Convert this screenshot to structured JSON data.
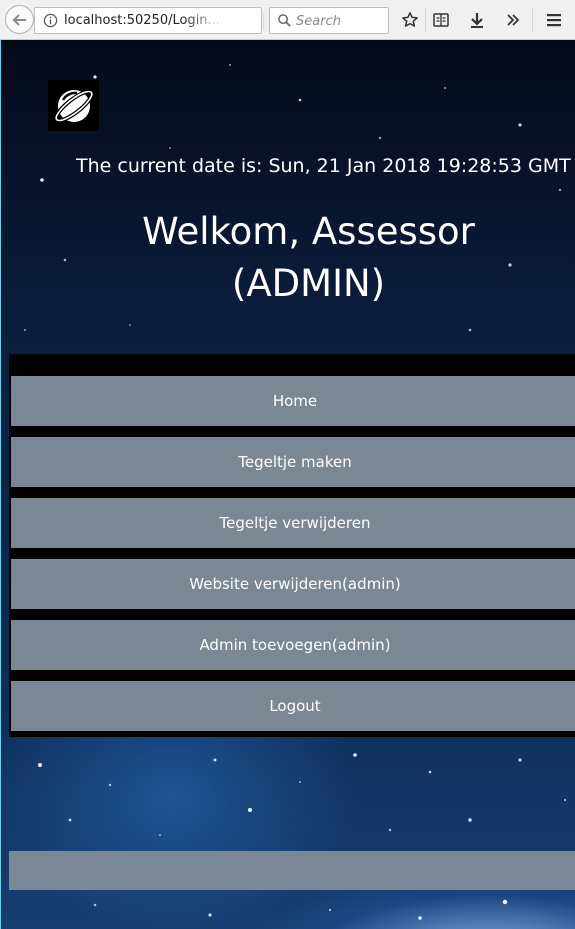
{
  "browser": {
    "url": "localhost:50250/Login...",
    "search_placeholder": "Search"
  },
  "page": {
    "date_text": "The current date is: Sun, 21 Jan 2018 19:28:53 GMT",
    "welcome_line1": "Welkom, Assessor",
    "welcome_line2": "(ADMIN)",
    "menu": [
      {
        "label": "Home"
      },
      {
        "label": "Tegeltje maken"
      },
      {
        "label": "Tegeltje verwijderen"
      },
      {
        "label": "Website verwijderen(admin)"
      },
      {
        "label": "Admin toevoegen(admin)"
      },
      {
        "label": "Logout"
      }
    ]
  }
}
